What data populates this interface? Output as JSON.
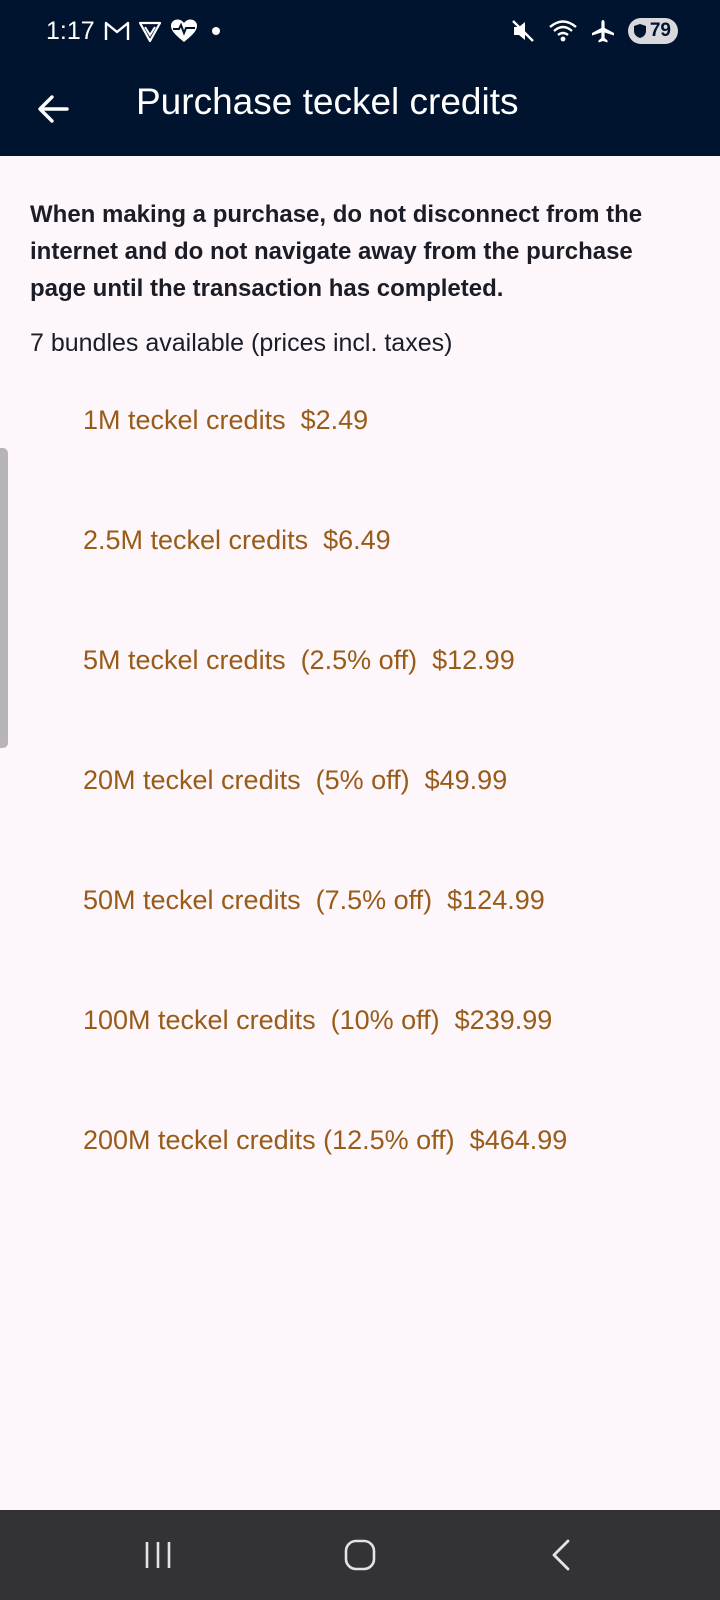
{
  "status_bar": {
    "time": "1:17",
    "battery_level": "79",
    "left_icons": [
      "gmail-icon",
      "vpn-shield-icon",
      "health-heart-icon",
      "notification-dot"
    ],
    "right_icons": [
      "mute-icon",
      "wifi-icon",
      "airplane-icon",
      "battery-icon"
    ]
  },
  "app_bar": {
    "title": "Purchase teckel credits",
    "back_icon": "arrow-left-icon"
  },
  "content": {
    "warning": "When making a purchase, do not disconnect from the internet and do not navigate away from the purchase page until the transaction has completed.",
    "bundles_count": "7 bundles available (prices incl. taxes)",
    "bundles": [
      {
        "label": "1M teckel credits  $2.49"
      },
      {
        "label": "2.5M teckel credits  $6.49"
      },
      {
        "label": "5M teckel credits  (2.5% off)  $12.99"
      },
      {
        "label": "20M teckel credits  (5% off)  $49.99"
      },
      {
        "label": "50M teckel credits  (7.5% off)  $124.99"
      },
      {
        "label": "100M teckel credits  (10% off)  $239.99"
      },
      {
        "label": "200M teckel credits (12.5% off)  $464.99"
      }
    ]
  },
  "colors": {
    "app_bar_bg": "#01142f",
    "page_bg": "#fdf7fb",
    "bundle_text": "#995b18",
    "body_text": "#1b1c26",
    "nav_bar_bg": "#333335"
  },
  "nav_bar": {
    "buttons": [
      "recents-icon",
      "home-icon",
      "back-icon"
    ]
  }
}
